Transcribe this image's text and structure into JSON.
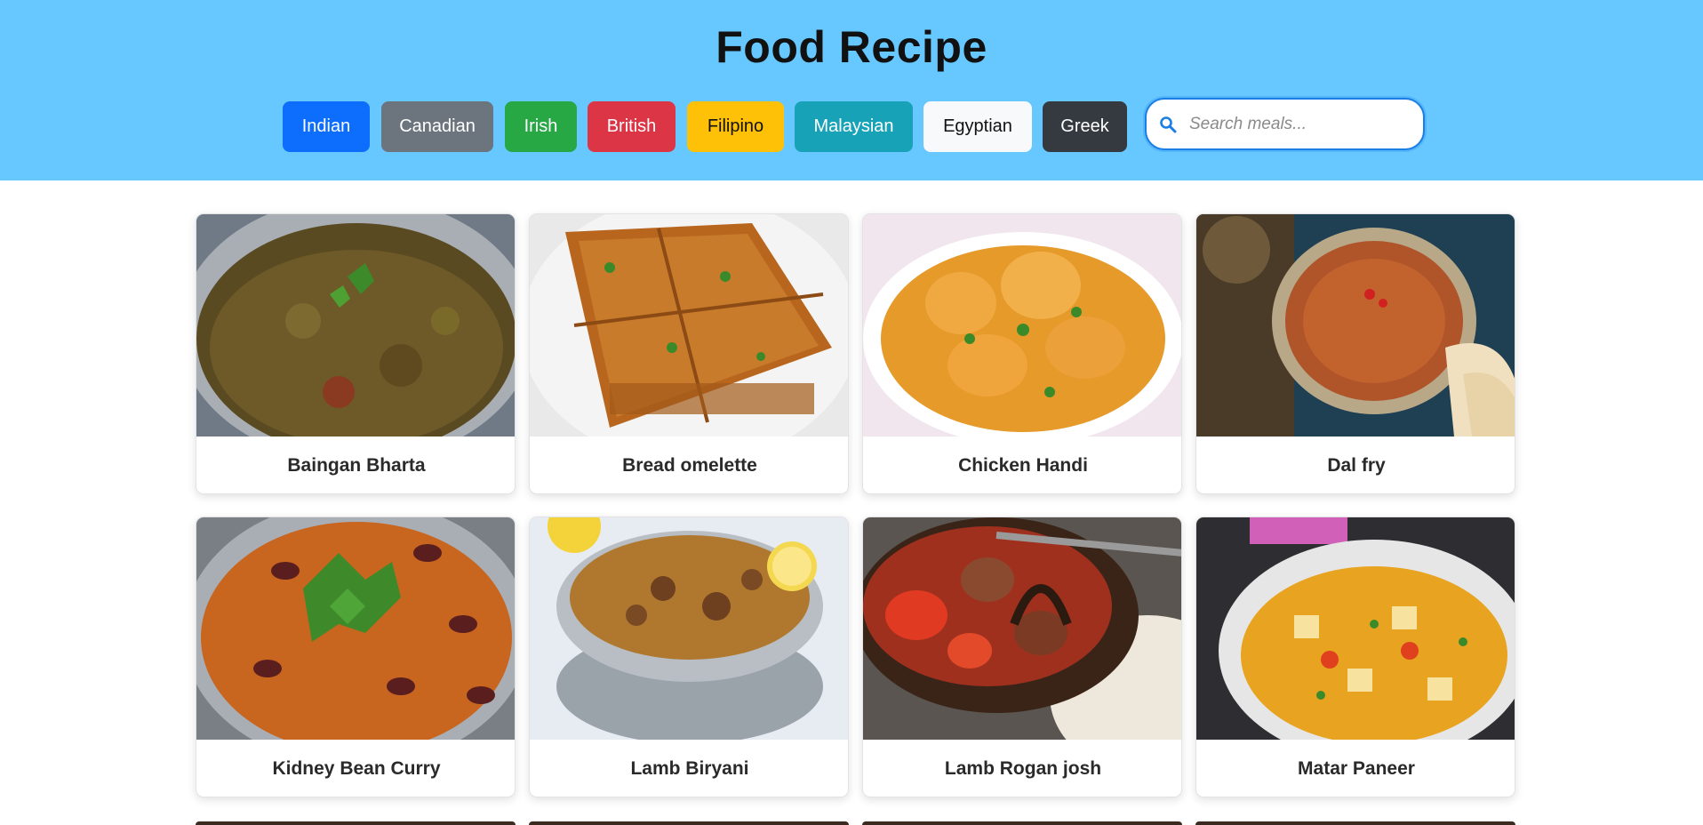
{
  "header": {
    "title": "Food Recipe",
    "cuisines": [
      {
        "label": "Indian",
        "bg": "#0d6efd",
        "fg": "#ffffff"
      },
      {
        "label": "Canadian",
        "bg": "#6c757d",
        "fg": "#ffffff"
      },
      {
        "label": "Irish",
        "bg": "#198754",
        "fg": "#ffffff"
      },
      {
        "label": "British",
        "bg": "#dc3545",
        "fg": "#ffffff"
      },
      {
        "label": "Filipino",
        "bg": "#ffc107",
        "fg": "#111111"
      },
      {
        "label": "Malaysian",
        "bg": "#17a2b8",
        "fg": "#ffffff"
      },
      {
        "label": "Egyptian",
        "bg": "#f8f9fa",
        "fg": "#111111"
      },
      {
        "label": "Greek",
        "bg": "#343a40",
        "fg": "#ffffff"
      }
    ],
    "search": {
      "placeholder": "Search meals...",
      "value": "",
      "icon": "search-icon"
    }
  },
  "meals": [
    {
      "name": "Baingan Bharta"
    },
    {
      "name": "Bread omelette"
    },
    {
      "name": "Chicken Handi"
    },
    {
      "name": "Dal fry"
    },
    {
      "name": "Kidney Bean Curry"
    },
    {
      "name": "Lamb Biryani"
    },
    {
      "name": "Lamb Rogan josh"
    },
    {
      "name": "Matar Paneer"
    }
  ],
  "colors": {
    "header_bg": "#66c8ff",
    "search_border": "#1a7ee6"
  }
}
